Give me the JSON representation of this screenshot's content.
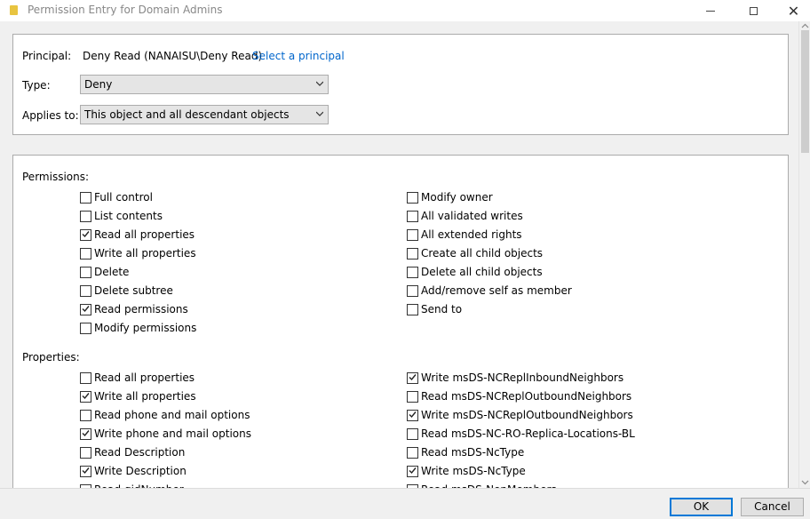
{
  "window": {
    "title": "Permission Entry for Domain Admins"
  },
  "header": {
    "principal_label": "Principal:",
    "principal_value": "Deny Read (NANAISU\\Deny Read)",
    "select_principal_link": "Select a principal",
    "type_label": "Type:",
    "type_value": "Deny",
    "applies_label": "Applies to:",
    "applies_value": "This object and all descendant objects"
  },
  "permissions": {
    "label": "Permissions:",
    "left": [
      {
        "label": "Full control",
        "checked": false
      },
      {
        "label": "List contents",
        "checked": false
      },
      {
        "label": "Read all properties",
        "checked": true
      },
      {
        "label": "Write all properties",
        "checked": false
      },
      {
        "label": "Delete",
        "checked": false
      },
      {
        "label": "Delete subtree",
        "checked": false
      },
      {
        "label": "Read permissions",
        "checked": true
      },
      {
        "label": "Modify permissions",
        "checked": false
      }
    ],
    "right": [
      {
        "label": "Modify owner",
        "checked": false
      },
      {
        "label": "All validated writes",
        "checked": false
      },
      {
        "label": "All extended rights",
        "checked": false
      },
      {
        "label": "Create all child objects",
        "checked": false
      },
      {
        "label": "Delete all child objects",
        "checked": false
      },
      {
        "label": "Add/remove self as member",
        "checked": false
      },
      {
        "label": "Send to",
        "checked": false
      }
    ]
  },
  "properties": {
    "label": "Properties:",
    "left": [
      {
        "label": "Read all properties",
        "checked": false
      },
      {
        "label": "Write all properties",
        "checked": true
      },
      {
        "label": "Read phone and mail options",
        "checked": false
      },
      {
        "label": "Write phone and mail options",
        "checked": true
      },
      {
        "label": "Read Description",
        "checked": false
      },
      {
        "label": "Write Description",
        "checked": true
      },
      {
        "label": "Read gidNumber",
        "checked": false
      }
    ],
    "right": [
      {
        "label": "Write msDS-NCReplInboundNeighbors",
        "checked": true
      },
      {
        "label": "Read msDS-NCReplOutboundNeighbors",
        "checked": false
      },
      {
        "label": "Write msDS-NCReplOutboundNeighbors",
        "checked": true
      },
      {
        "label": "Read msDS-NC-RO-Replica-Locations-BL",
        "checked": false
      },
      {
        "label": "Read msDS-NcType",
        "checked": false
      },
      {
        "label": "Write msDS-NcType",
        "checked": true
      },
      {
        "label": "Read msDS-NonMembers",
        "checked": false
      }
    ]
  },
  "buttons": {
    "ok": "OK",
    "cancel": "Cancel"
  }
}
